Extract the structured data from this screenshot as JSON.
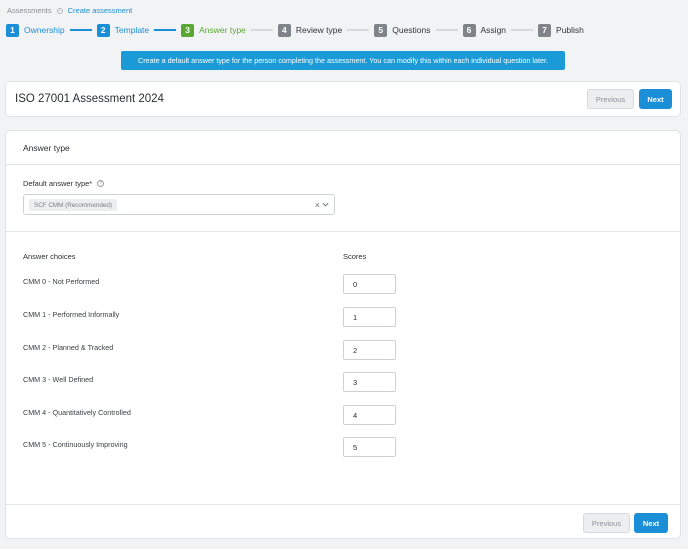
{
  "breadcrumb": {
    "root": "Assessments",
    "current": "Create assessment"
  },
  "steps": [
    {
      "num": "1",
      "label": "Ownership",
      "state": "done"
    },
    {
      "num": "2",
      "label": "Template",
      "state": "done"
    },
    {
      "num": "3",
      "label": "Answer type",
      "state": "active"
    },
    {
      "num": "4",
      "label": "Review type",
      "state": "todo"
    },
    {
      "num": "5",
      "label": "Questions",
      "state": "todo"
    },
    {
      "num": "6",
      "label": "Assign",
      "state": "todo"
    },
    {
      "num": "7",
      "label": "Publish",
      "state": "todo"
    }
  ],
  "info_banner": "Create a default answer type for the person completing the assessment. You can modify this within each individual question later.",
  "header": {
    "title": "ISO 27001 Assessment 2024",
    "previous_label": "Previous",
    "next_label": "Next"
  },
  "answer_type": {
    "section_title": "Answer type",
    "field_label": "Default answer type*",
    "selected_value": "SCF CMM (Recommended)",
    "clear_symbol": "×",
    "help_symbol": "?"
  },
  "choices": {
    "col_choices": "Answer choices",
    "col_scores": "Scores",
    "rows": [
      {
        "label": "CMM 0 - Not Performed",
        "score": "0"
      },
      {
        "label": "CMM 1 - Performed Informally",
        "score": "1"
      },
      {
        "label": "CMM 2 - Planned & Tracked",
        "score": "2"
      },
      {
        "label": "CMM 3 - Well Defined",
        "score": "3"
      },
      {
        "label": "CMM 4 - Quantitatively Controlled",
        "score": "4"
      },
      {
        "label": "CMM 5 - Continuously Improving",
        "score": "5"
      }
    ]
  },
  "footer": {
    "previous_label": "Previous",
    "next_label": "Next"
  },
  "colors": {
    "accent": "#1a8fd8",
    "active_step": "#5aa732",
    "todo_step": "#7f848a",
    "banner": "#1a9bd7"
  }
}
